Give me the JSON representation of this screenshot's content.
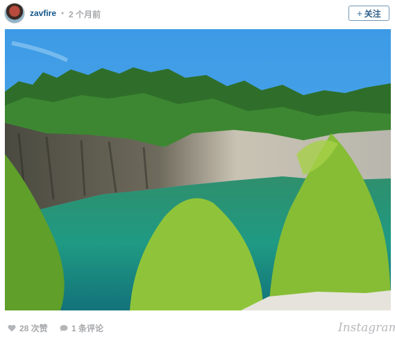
{
  "header": {
    "username": "zavfire",
    "separator": "•",
    "timestamp": "2 个月前",
    "follow_label": "关注"
  },
  "photo": {
    "subject": "quarry-lake-landscape"
  },
  "footer": {
    "likes": "28 次赞",
    "comments": "1 条评论",
    "brand": "Instagram"
  },
  "colors": {
    "username": "#125688",
    "muted": "#a5a7aa",
    "follow_border": "#6f97b6"
  }
}
